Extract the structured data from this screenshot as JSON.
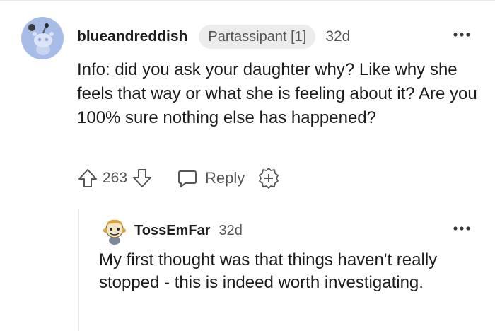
{
  "comment": {
    "username": "blueandreddish",
    "flair": "Partassipant [1]",
    "age": "32d",
    "body": "Info: did you ask your daughter why? Like why she feels that way or what she is feeling about it? Are you 100% sure nothing else has happened?",
    "score": "263",
    "reply_label": "Reply",
    "avatar_icon": "snoo-avatar-icon",
    "more_icon": "more-options-icon"
  },
  "reply": {
    "username": "TossEmFar",
    "age": "32d",
    "body": "My first thought was that things haven't really stopped - this is indeed worth investigating.",
    "avatar_icon": "custom-avatar-icon",
    "more_icon": "more-options-icon"
  },
  "colors": {
    "text": "#1c1c1c",
    "muted": "#555555",
    "flair_bg": "#ececec",
    "avatar_bg": "#a8bce8",
    "thread_line": "#e8e8e8"
  }
}
